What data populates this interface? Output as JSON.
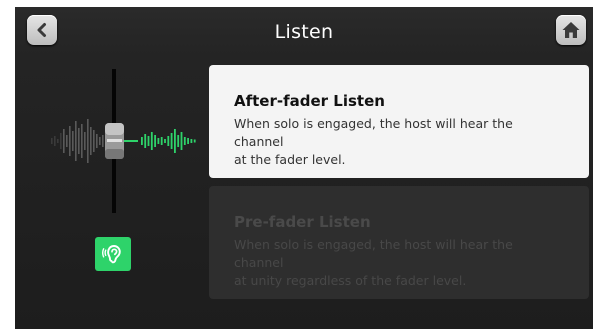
{
  "header": {
    "title": "Listen",
    "back_icon": "chevron-left-icon",
    "home_icon": "home-icon"
  },
  "options": [
    {
      "title": "After-fader Listen",
      "description_line1": "When solo is engaged, the host will hear the channel",
      "description_line2": "at the fader level.",
      "selected": true
    },
    {
      "title": "Pre-fader Listen",
      "description_line1": "When solo is engaged, the host will hear the channel",
      "description_line2": "at unity regardless of the fader level.",
      "selected": false
    }
  ],
  "illustration": {
    "fader_icon": "fader-waveform-icon",
    "listen_icon": "ear-listen-icon"
  },
  "colors": {
    "accent": "#2ed36a",
    "card_selected": "#f4f4f4",
    "card_unselected": "#2e2e2e"
  }
}
